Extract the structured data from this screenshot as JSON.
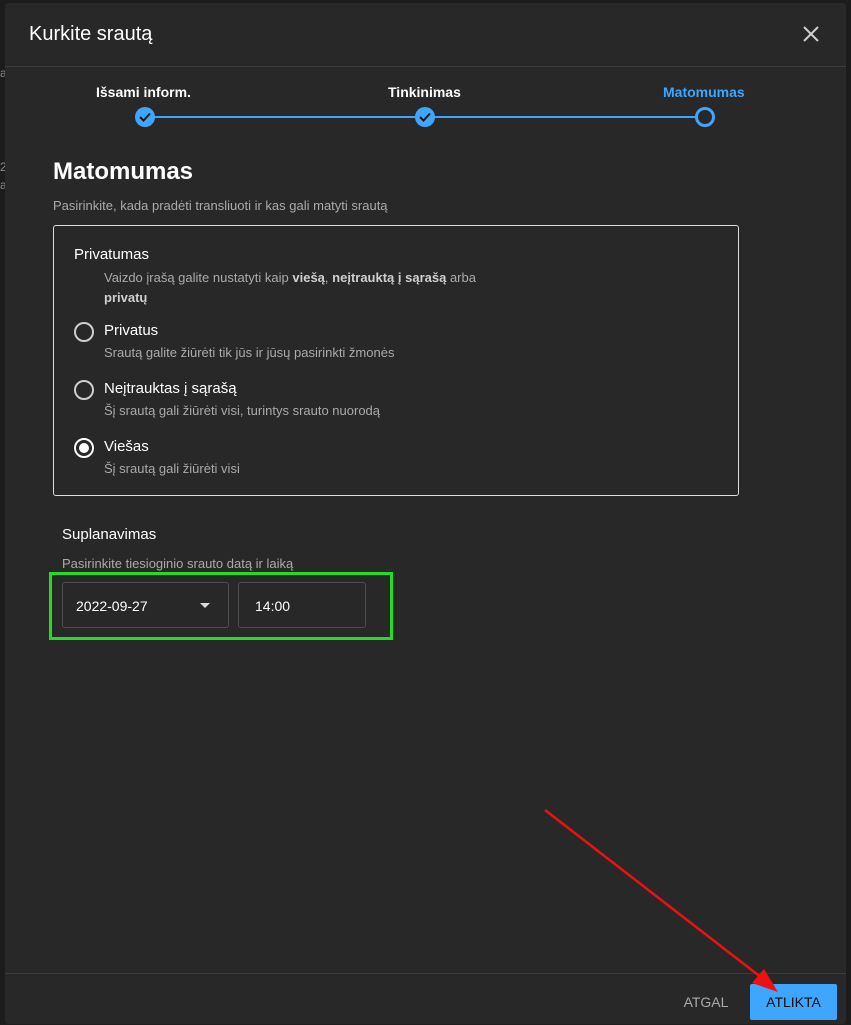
{
  "dialog": {
    "title": "Kurkite srautą",
    "close_icon": "close-icon"
  },
  "stepper": {
    "steps": [
      {
        "label": "Išsami inform.",
        "state": "done"
      },
      {
        "label": "Tinkinimas",
        "state": "done"
      },
      {
        "label": "Matomumas",
        "state": "current"
      }
    ],
    "accent": "#3ea6ff"
  },
  "visibility": {
    "title": "Matomumas",
    "subtitle": "Pasirinkite, kada pradėti transliuoti ir kas gali matyti srautą"
  },
  "privacy": {
    "title": "Privatumas",
    "desc_prefix": "Vaizdo įrašą galite nustatyti kaip ",
    "desc_public": "viešą",
    "desc_sep": ", ",
    "desc_unlisted": "neįtrauktą į sąrašą",
    "desc_or": " arba",
    "desc_private": "privatų",
    "options": [
      {
        "label": "Privatus",
        "desc": "Srautą galite žiūrėti tik jūs ir jūsų pasirinkti žmonės",
        "checked": false
      },
      {
        "label": "Neįtrauktas į sąrašą",
        "desc": "Šį srautą gali žiūrėti visi, turintys srauto nuorodą",
        "checked": false
      },
      {
        "label": "Viešas",
        "desc": "Šį srautą gali žiūrėti visi",
        "checked": true
      }
    ]
  },
  "schedule": {
    "title": "Suplanavimas",
    "subtitle": "Pasirinkite tiesioginio srauto datą ir laiką",
    "date": "2022-09-27",
    "time": "14:00"
  },
  "footer": {
    "back_label": "ATGAL",
    "done_label": "ATLIKTA"
  },
  "annotations": {
    "highlight_color": "#22dd22",
    "arrow_color": "#ee1111"
  }
}
